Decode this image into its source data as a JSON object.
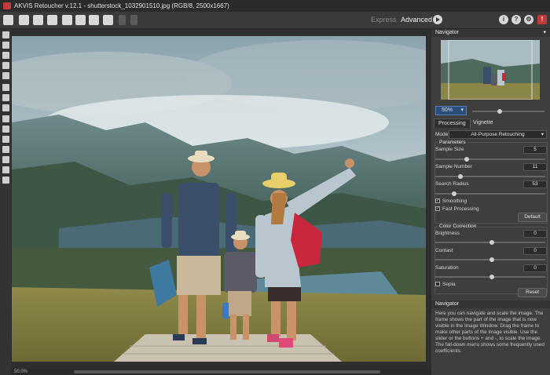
{
  "window": {
    "title": "AKVIS Retoucher v.12.1 - shutterstock_1032901510.jpg (RGB/8, 2500x1667)"
  },
  "toolbar": {
    "mode_express": "Express",
    "mode_advanced": "Advanced"
  },
  "status": {
    "zoom": "50.0%"
  },
  "navigator": {
    "title": "Navigator",
    "zoom": "50%"
  },
  "tabs": {
    "processing": "Processing",
    "vignette": "Vignette"
  },
  "processing": {
    "mode_label": "Mode:",
    "mode_value": "All-Purpose Retouching",
    "parameters_title": "Parameters",
    "sample_size_label": "Sample Size",
    "sample_size_value": "5",
    "sample_number_label": "Sample Number",
    "sample_number_value": "11",
    "search_radius_label": "Search Radius",
    "search_radius_value": "53",
    "smoothing_label": "Smoothing",
    "fast_processing_label": "Fast Processing",
    "default_button": "Default",
    "color_correction_title": "Color Correction",
    "brightness_label": "Brightness",
    "brightness_value": "0",
    "contrast_label": "Contast",
    "contrast_value": "0",
    "saturation_label": "Saturation",
    "saturation_value": "0",
    "sepia_label": "Sepia",
    "reset_button": "Reset"
  },
  "help": {
    "title": "Navigator",
    "text": "Here you can navigate and scale the image. The frame shows the part of the image that is now visible in the Image Window. Drag the frame to make other parts of the image visible. Use the slider or the buttons + and -, to scale the image. The fall-down menu shows some frequently used coefficients."
  }
}
